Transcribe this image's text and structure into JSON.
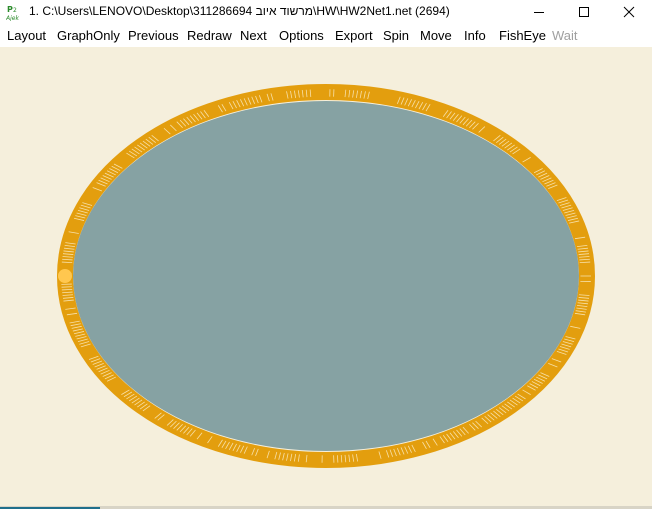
{
  "window": {
    "title": "1. C:\\Users\\LENOVO\\Desktop\\311286694 מרשוד איוב\\HW\\HW2Net1.net (2694)",
    "icon": "pajek-app-icon",
    "controls": {
      "minimize_icon": "minimize-icon",
      "maximize_icon": "maximize-icon",
      "close_icon": "close-icon"
    }
  },
  "menu": {
    "items": [
      {
        "label": "Layout",
        "enabled": true
      },
      {
        "label": "GraphOnly",
        "enabled": true
      },
      {
        "label": "Previous",
        "enabled": true
      },
      {
        "label": "Redraw",
        "enabled": true
      },
      {
        "label": "Next",
        "enabled": true
      },
      {
        "label": "Options",
        "enabled": true
      },
      {
        "label": "Export",
        "enabled": true
      },
      {
        "label": "Spin",
        "enabled": true
      },
      {
        "label": "Move",
        "enabled": true
      },
      {
        "label": "Info",
        "enabled": true
      },
      {
        "label": "FishEye",
        "enabled": true
      },
      {
        "label": "Wait",
        "enabled": false
      }
    ]
  },
  "graph": {
    "vertex_count": 2694,
    "layout_shape": "ellipse",
    "colors": {
      "background": "#f5efdc",
      "ring_vertices": "#e39e0e",
      "edge_fill": "#86a2a3",
      "highlight_vertex": "#ffc74f",
      "vertex_tick": "#f7e0a8"
    }
  }
}
